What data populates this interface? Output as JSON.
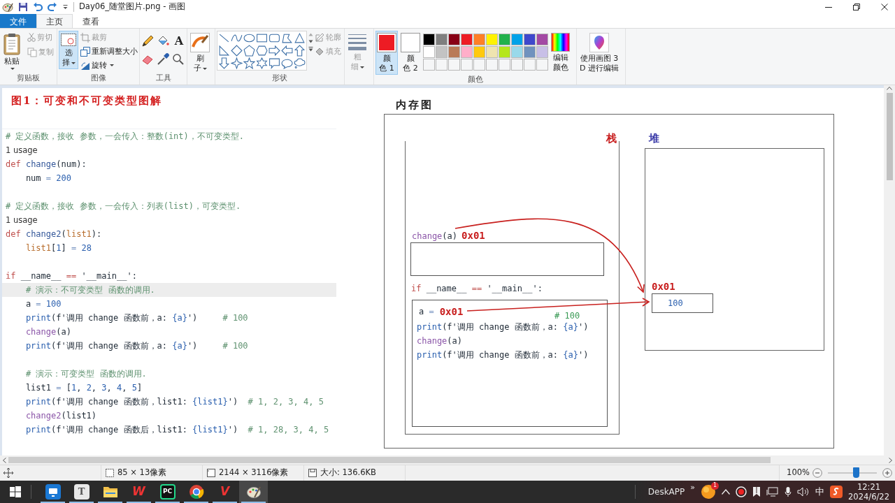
{
  "window": {
    "title": "Day06_随堂图片.png - 画图"
  },
  "ribbon_tabs": [
    {
      "label": "文件",
      "kind": "file",
      "selected": false
    },
    {
      "label": "主页",
      "kind": "tab",
      "selected": true
    },
    {
      "label": "查看",
      "kind": "tab",
      "selected": false
    }
  ],
  "clipboard": {
    "label": "剪贴板",
    "paste": "粘贴",
    "items": [
      {
        "label": "剪切",
        "kind": "cut",
        "disabled": true
      },
      {
        "label": "复制",
        "kind": "copy",
        "disabled": true
      }
    ]
  },
  "image_group": {
    "label": "图像",
    "select": {
      "label_lines": [
        "选",
        "择"
      ],
      "selected": true
    },
    "items": [
      {
        "label": "裁剪",
        "kind": "crop",
        "disabled": true,
        "dropdown": false
      },
      {
        "label": "重新调整大小",
        "kind": "resize",
        "disabled": false,
        "dropdown": false
      },
      {
        "label": "旋转",
        "kind": "rotate",
        "disabled": false,
        "dropdown": true
      }
    ]
  },
  "tools": {
    "label": "工具",
    "text_tool": "A"
  },
  "brushes": {
    "label_lines": [
      "刷",
      "子"
    ]
  },
  "shapes": {
    "label": "形状",
    "options": [
      {
        "label": "轮廓",
        "kind": "outline",
        "disabled": true
      },
      {
        "label": "填充",
        "kind": "fill",
        "disabled": true
      }
    ]
  },
  "size": {
    "label_lines": [
      "粗",
      "细"
    ],
    "disabled": true
  },
  "colors": {
    "label": "颜色",
    "slots": [
      {
        "label_lines": [
          "颜",
          "色 1"
        ],
        "color": "#ed1c24",
        "selected": true
      },
      {
        "label_lines": [
          "颜",
          "色 2"
        ],
        "color": "#ffffff",
        "selected": false
      }
    ],
    "palette": [
      {
        "color": "#000000"
      },
      {
        "color": "#7f7f7f"
      },
      {
        "color": "#880015"
      },
      {
        "color": "#ed1c24"
      },
      {
        "color": "#ff7f27"
      },
      {
        "color": "#fff200"
      },
      {
        "color": "#22b14c"
      },
      {
        "color": "#00a2e8"
      },
      {
        "color": "#3f48cc"
      },
      {
        "color": "#a349a4"
      },
      {
        "color": "#ffffff"
      },
      {
        "color": "#c3c3c3"
      },
      {
        "color": "#b97a57"
      },
      {
        "color": "#ffaec9"
      },
      {
        "color": "#ffc90e"
      },
      {
        "color": "#efe4b0"
      },
      {
        "color": "#b5e61d"
      },
      {
        "color": "#99d9ea"
      },
      {
        "color": "#7092be"
      },
      {
        "color": "#c8bfe7"
      }
    ],
    "edit": {
      "label_lines": [
        "编辑",
        "颜色"
      ]
    }
  },
  "paint3d": {
    "label_lines": [
      "使用画图 3",
      "D 进行编辑"
    ]
  },
  "drawing": {
    "heading": "图1：可变和不可变类型图解",
    "code_blocks": [
      {
        "lines": [
          {
            "highlighted": false,
            "segments": [
              {
                "text": "# 定义函数，接收 参数，一会传入：整数(int)，不可变类型.",
                "kind": "comment"
              }
            ]
          },
          {
            "highlighted": false,
            "segments": [
              {
                "text": "1 usage",
                "kind": "hint"
              }
            ]
          },
          {
            "highlighted": false,
            "segments": [
              {
                "text": "def",
                "kind": "kw"
              },
              {
                "text": " change",
                "kind": "defname"
              },
              {
                "text": "(num):",
                "kind": "plain"
              }
            ]
          },
          {
            "highlighted": false,
            "segments": [
              {
                "text": "    num ",
                "kind": "plain"
              },
              {
                "text": "=",
                "kind": "op"
              },
              {
                "text": " 200",
                "kind": "num"
              }
            ]
          }
        ]
      },
      {
        "lines": [
          {
            "highlighted": false,
            "segments": [
              {
                "text": "# 定义函数，接收 参数，一会传入：列表(list)，可变类型.",
                "kind": "comment"
              }
            ]
          },
          {
            "highlighted": false,
            "segments": [
              {
                "text": "1 usage",
                "kind": "hint"
              }
            ]
          },
          {
            "highlighted": false,
            "segments": [
              {
                "text": "def",
                "kind": "kw"
              },
              {
                "text": " change2",
                "kind": "defname"
              },
              {
                "text": "(",
                "kind": "plain"
              },
              {
                "text": "list1",
                "kind": "param"
              },
              {
                "text": "):",
                "kind": "plain"
              }
            ]
          },
          {
            "highlighted": false,
            "segments": [
              {
                "text": "    list1",
                "kind": "param"
              },
              {
                "text": "[",
                "kind": "plain"
              },
              {
                "text": "1",
                "kind": "num"
              },
              {
                "text": "] ",
                "kind": "plain"
              },
              {
                "text": "=",
                "kind": "op"
              },
              {
                "text": " 28",
                "kind": "num"
              }
            ]
          }
        ]
      },
      {
        "lines": [
          {
            "highlighted": false,
            "segments": [
              {
                "text": "if",
                "kind": "kw"
              },
              {
                "text": " __name__ ",
                "kind": "plain"
              },
              {
                "text": "==",
                "kind": "kw"
              },
              {
                "text": " '__main__':",
                "kind": "plain"
              }
            ]
          },
          {
            "highlighted": true,
            "segments": [
              {
                "text": "    # 演示：不可变类型 函数的调用.",
                "kind": "comment"
              }
            ]
          },
          {
            "highlighted": false,
            "segments": [
              {
                "text": "    a ",
                "kind": "plain"
              },
              {
                "text": "=",
                "kind": "op"
              },
              {
                "text": " 100",
                "kind": "num"
              }
            ]
          },
          {
            "highlighted": false,
            "segments": [
              {
                "text": "    print",
                "kind": "builtin"
              },
              {
                "text": "(f'调用 change 函数前，a: ",
                "kind": "plain"
              },
              {
                "text": "{a}",
                "kind": "interp"
              },
              {
                "text": "')",
                "kind": "plain"
              },
              {
                "text": "     # 100",
                "kind": "comment"
              }
            ]
          },
          {
            "highlighted": false,
            "segments": [
              {
                "text": "    change",
                "kind": "call"
              },
              {
                "text": "(a)",
                "kind": "plain"
              }
            ]
          },
          {
            "highlighted": false,
            "segments": [
              {
                "text": "    print",
                "kind": "builtin"
              },
              {
                "text": "(f'调用 change 函数前，a: ",
                "kind": "plain"
              },
              {
                "text": "{a}",
                "kind": "interp"
              },
              {
                "text": "')",
                "kind": "plain"
              },
              {
                "text": "     # 100",
                "kind": "comment"
              }
            ]
          }
        ]
      },
      {
        "lines": [
          {
            "highlighted": false,
            "segments": [
              {
                "text": "    # 演示：可变类型 函数的调用.",
                "kind": "comment"
              }
            ]
          },
          {
            "highlighted": false,
            "segments": [
              {
                "text": "    list1 ",
                "kind": "plain"
              },
              {
                "text": "=",
                "kind": "op"
              },
              {
                "text": " [",
                "kind": "plain"
              },
              {
                "text": "1",
                "kind": "num"
              },
              {
                "text": ", ",
                "kind": "plain"
              },
              {
                "text": "2",
                "kind": "num"
              },
              {
                "text": ", ",
                "kind": "plain"
              },
              {
                "text": "3",
                "kind": "num"
              },
              {
                "text": ", ",
                "kind": "plain"
              },
              {
                "text": "4",
                "kind": "num"
              },
              {
                "text": ", ",
                "kind": "plain"
              },
              {
                "text": "5",
                "kind": "num"
              },
              {
                "text": "]",
                "kind": "plain"
              }
            ]
          },
          {
            "highlighted": false,
            "segments": [
              {
                "text": "    print",
                "kind": "builtin"
              },
              {
                "text": "(f'调用 change 函数前，list1: ",
                "kind": "plain"
              },
              {
                "text": "{list1}",
                "kind": "interp"
              },
              {
                "text": "')",
                "kind": "plain"
              },
              {
                "text": "  # 1, 2, 3, 4, 5",
                "kind": "comment"
              }
            ]
          },
          {
            "highlighted": false,
            "segments": [
              {
                "text": "    change2",
                "kind": "call"
              },
              {
                "text": "(list1)",
                "kind": "plain"
              }
            ]
          },
          {
            "highlighted": false,
            "segments": [
              {
                "text": "    print",
                "kind": "builtin"
              },
              {
                "text": "(f'调用 change 函数后，list1: ",
                "kind": "plain"
              },
              {
                "text": "{list1}",
                "kind": "interp"
              },
              {
                "text": "')",
                "kind": "plain"
              },
              {
                "text": "  # 1, 28, 3, 4, 5",
                "kind": "comment"
              }
            ]
          }
        ]
      }
    ],
    "diagram": {
      "title": "内存图",
      "stack_label": "栈",
      "heap_label": "堆",
      "frame_call": [
        {
          "text": "change",
          "kind": "call"
        },
        {
          "text": "(a)",
          "kind": "plain"
        }
      ],
      "frame_address": "0x01",
      "main_header": [
        {
          "text": "if",
          "kind": "kw"
        },
        {
          "text": " __name__ ",
          "kind": "plain"
        },
        {
          "text": "==",
          "kind": "kw"
        },
        {
          "text": " '__main__':",
          "kind": "plain"
        }
      ],
      "main_lines": [
        {
          "segments": [
            {
              "text": "a ",
              "kind": "plain"
            },
            {
              "text": "=",
              "kind": "op"
            }
          ],
          "address": "0x01"
        },
        {
          "segments": [
            {
              "text": "print",
              "kind": "builtin"
            },
            {
              "text": "(f'调用 change 函数前，a: ",
              "kind": "plain"
            },
            {
              "text": "{a}",
              "kind": "interp"
            },
            {
              "text": "')",
              "kind": "plain"
            }
          ]
        },
        {
          "segments": [
            {
              "text": "change",
              "kind": "call"
            },
            {
              "text": "(a)",
              "kind": "plain"
            }
          ]
        },
        {
          "segments": [
            {
              "text": "print",
              "kind": "builtin"
            },
            {
              "text": "(f'调用 change 函数前，a: ",
              "kind": "plain"
            },
            {
              "text": "{a}",
              "kind": "interp"
            },
            {
              "text": "')",
              "kind": "plain"
            }
          ]
        }
      ],
      "note": "# 100",
      "heap_address": "0x01",
      "heap_value": "100"
    }
  },
  "status_bar": {
    "selection_size": "85 × 13像素",
    "canvas_size": "2144 × 3116像素",
    "file_size": "大小: 136.6KB",
    "zoom": "100%",
    "zoom_slider": {
      "level": 0.57
    }
  },
  "taskbar": {
    "apps": [
      {
        "kind": "remote",
        "running": true,
        "active": false
      },
      {
        "kind": "tile",
        "label": "T",
        "running": true,
        "active": false
      },
      {
        "kind": "folder",
        "running": true,
        "active": false
      },
      {
        "kind": "wps",
        "label": "W",
        "running": true,
        "active": false
      },
      {
        "kind": "ide",
        "label": "PC",
        "running": true,
        "active": false
      },
      {
        "kind": "browser",
        "running": true,
        "active": false
      },
      {
        "kind": "video",
        "label": "V",
        "running": true,
        "active": false
      },
      {
        "kind": "paint",
        "running": true,
        "active": true
      }
    ],
    "tray": {
      "deskapp": "DeskAPP",
      "more": "»",
      "badge": "1",
      "ime": "中",
      "time": "12:21",
      "date": "2024/6/22"
    }
  }
}
